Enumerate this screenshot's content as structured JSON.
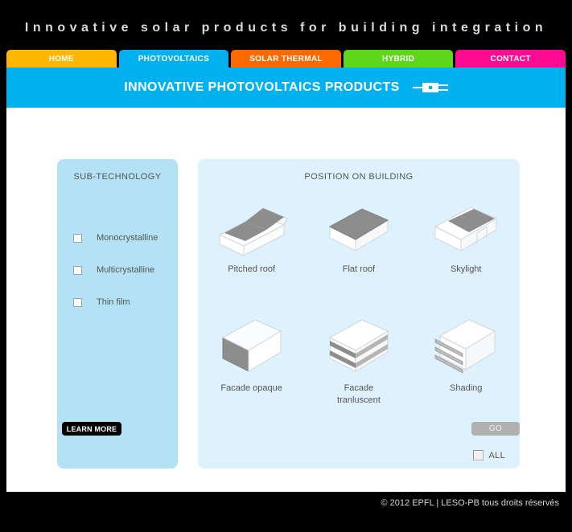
{
  "site": {
    "tagline": "Innovative solar products for building integration"
  },
  "nav": {
    "tabs": [
      {
        "label": "HOME",
        "color": "#ffb600",
        "active": false,
        "name": "home"
      },
      {
        "label": "PHOTOVOLTAICS",
        "color": "#00b0ef",
        "active": true,
        "name": "photovoltaics"
      },
      {
        "label": "SOLAR THERMAL",
        "color": "#fb6a00",
        "active": false,
        "name": "solar-thermal"
      },
      {
        "label": "HYBRID",
        "color": "#5cd71a",
        "active": false,
        "name": "hybrid"
      },
      {
        "label": "CONTACT",
        "color": "#ff0b93",
        "active": false,
        "name": "contact"
      }
    ]
  },
  "banner": {
    "title": "INNOVATIVE PHOTOVOLTAICS PRODUCTS",
    "icon": "plug-connector-icon",
    "background": "#00b0ef"
  },
  "subtech_panel": {
    "heading": "SUB-TECHNOLOGY",
    "background": "#b2e2f4",
    "options": [
      {
        "label": "Monocrystalline",
        "checked": false
      },
      {
        "label": "Multicrystalline",
        "checked": false
      },
      {
        "label": "Thin film",
        "checked": false
      }
    ]
  },
  "position_panel": {
    "heading": "POSITION ON BUILDING",
    "background": "#ddf2fc",
    "items": [
      {
        "label": "Pitched roof",
        "icon": "pitched-roof-icon"
      },
      {
        "label": "Flat roof",
        "icon": "flat-roof-icon"
      },
      {
        "label": "Skylight",
        "icon": "skylight-icon"
      },
      {
        "label": "Facade opaque",
        "icon": "facade-opaque-icon"
      },
      {
        "label": "Facade\ntranluscent",
        "icon": "facade-tranluscent-icon"
      },
      {
        "label": "Shading",
        "icon": "shading-icon"
      }
    ],
    "all_checkbox": {
      "label": "ALL",
      "checked": false
    }
  },
  "buttons": {
    "learn_more": "LEARN MORE",
    "go": "GO"
  },
  "footer": {
    "copyright": "© 2012 EPFL | LESO-PB tous droits réservés"
  }
}
